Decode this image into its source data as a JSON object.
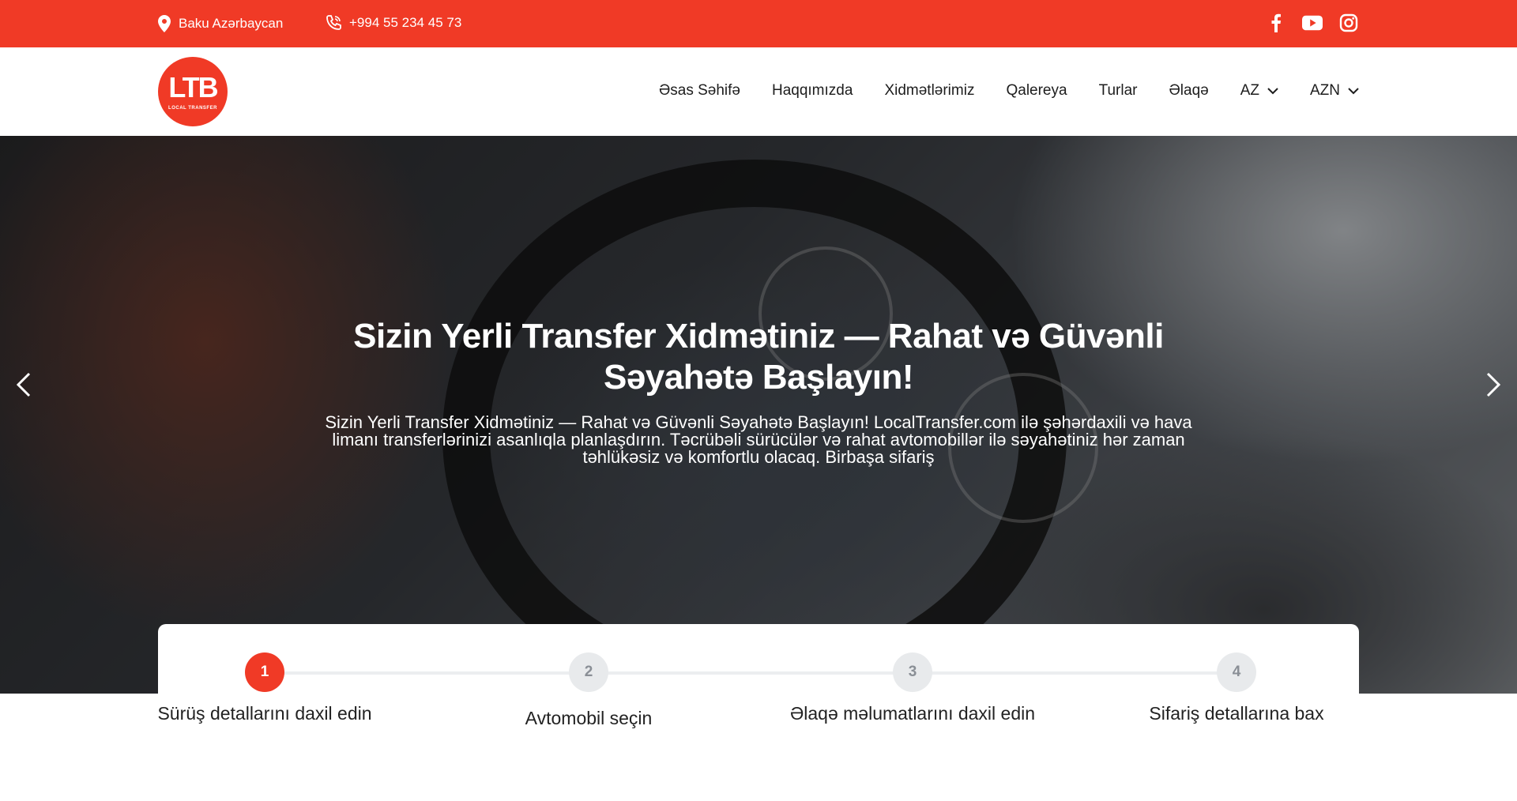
{
  "topbar": {
    "location": "Baku Azərbaycan",
    "phone": "+994 55 234 45 73",
    "socials": [
      "facebook-icon",
      "youtube-icon",
      "instagram-icon"
    ]
  },
  "logo": {
    "text": "LTB",
    "subtitle": "LOCAL TRANSFER"
  },
  "nav": {
    "items": [
      "Əsas Səhifə",
      "Haqqımızda",
      "Xidmətlərimiz",
      "Qalereya",
      "Turlar",
      "Əlaqə"
    ],
    "language": "AZ",
    "currency": "AZN"
  },
  "hero": {
    "title": "Sizin Yerli Transfer Xidmətiniz — Rahat və Güvənli Səyahətə Başlayın!",
    "text": "Sizin Yerli Transfer Xidmətiniz — Rahat və Güvənli Səyahətə Başlayın! LocalTransfer.com ilə şəhərdaxili və hava limanı transferlərinizi asanlıqla planlaşdırın. Təcrübəli sürücülər və rahat avtomobillər ilə səyahətiniz hər zaman təhlükəsiz və komfortlu olacaq. Birbaşa sifariş"
  },
  "steps": [
    {
      "number": "1",
      "label": "Sürüş detallarını daxil edin",
      "active": true
    },
    {
      "number": "2",
      "label": "Avtomobil seçin",
      "active": false
    },
    {
      "number": "3",
      "label": "Əlaqə məlumatlarını daxil edin",
      "active": false
    },
    {
      "number": "4",
      "label": "Sifariş detallarına bax",
      "active": false
    }
  ],
  "colors": {
    "brand": "#f03a26",
    "step_inactive": "#e8eaec"
  }
}
